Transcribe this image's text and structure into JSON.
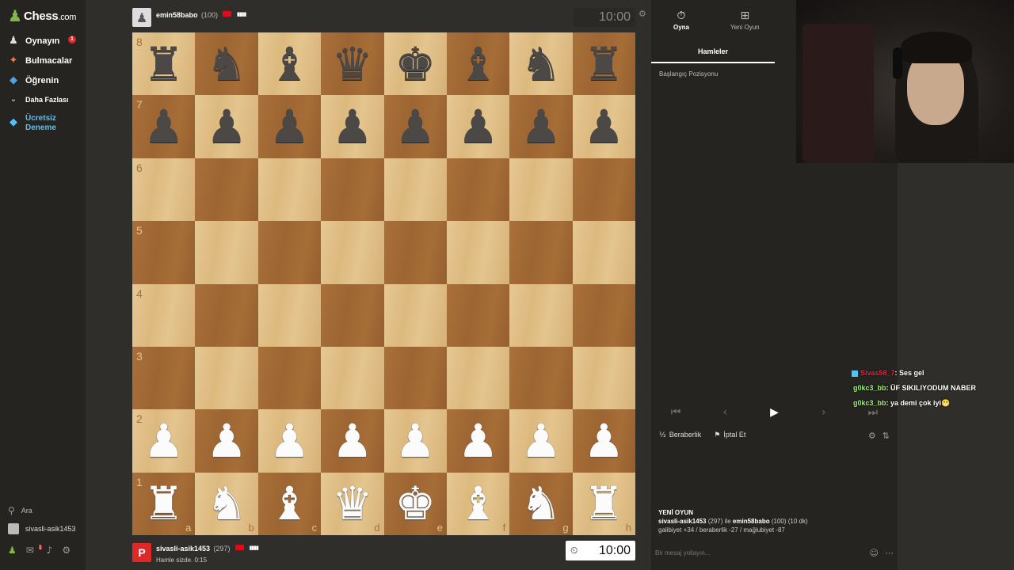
{
  "brand": {
    "logo_text": "Chess",
    "logo_suffix": ".com"
  },
  "sidebar": {
    "items": [
      {
        "label": "Oynayın",
        "icon": "play-pawn-icon",
        "badge": "1"
      },
      {
        "label": "Bulmacalar",
        "icon": "puzzle-icon"
      },
      {
        "label": "Öğrenin",
        "icon": "learn-cap-icon"
      },
      {
        "label": "Daha Fazlası",
        "icon": "chevron-down-icon"
      }
    ],
    "trial_line1": "Ücretsiz",
    "trial_line2": "Deneme",
    "search_label": "Ara",
    "user_label": "sivasli-asik1453",
    "friends_badge": "1"
  },
  "opponent": {
    "name": "emin58babo",
    "rating": "(100)",
    "clock": "10:00"
  },
  "player": {
    "name": "sivasli-asik1453",
    "rating": "(297)",
    "status": "Hamle sizde. 0:15",
    "clock": "10:00"
  },
  "board": {
    "ranks": [
      "8",
      "7",
      "6",
      "5",
      "4",
      "3",
      "2",
      "1"
    ],
    "files": [
      "a",
      "b",
      "c",
      "d",
      "e",
      "f",
      "g",
      "h"
    ],
    "position": [
      [
        "br",
        "bn",
        "bb",
        "bq",
        "bk",
        "bb",
        "bn",
        "br"
      ],
      [
        "bp",
        "bp",
        "bp",
        "bp",
        "bp",
        "bp",
        "bp",
        "bp"
      ],
      [
        "",
        "",
        "",
        "",
        "",
        "",
        "",
        ""
      ],
      [
        "",
        "",
        "",
        "",
        "",
        "",
        "",
        ""
      ],
      [
        "",
        "",
        "",
        "",
        "",
        "",
        "",
        ""
      ],
      [
        "",
        "",
        "",
        "",
        "",
        "",
        "",
        ""
      ],
      [
        "wp",
        "wp",
        "wp",
        "wp",
        "wp",
        "wp",
        "wp",
        "wp"
      ],
      [
        "wr",
        "wn",
        "wb",
        "wq",
        "wk",
        "wb",
        "wn",
        "wr"
      ]
    ]
  },
  "panel": {
    "tab_play": "Oyna",
    "tab_new": "Yeni Oyun",
    "subtab_moves": "Hamleler",
    "start_position": "Başlangıç Pozisyonu",
    "draw_label": "Beraberlik",
    "abort_label": "İptal Et",
    "game_title": "YENİ OYUN",
    "game_white": "sivasli-asik1453",
    "game_white_rating": "(297)",
    "game_with": "ile",
    "game_black": "emin58babo",
    "game_black_rating": "(100)",
    "game_mode": "(10 dk)",
    "game_stats": "galibiyet +34 / beraberlik -27 / mağlubiyet -87",
    "message_placeholder": "Bir mesaj yollayın..."
  },
  "stream_chat": [
    {
      "user": "Sivas58_7",
      "text": ": Ses gel",
      "color": "red"
    },
    {
      "user": "g0kc3_bb",
      "text": ": ÜF SIKILIYODUM NABER",
      "color": "green"
    },
    {
      "user": "g0kc3_bb",
      "text": ": ya demi çok iyi😁",
      "color": "green"
    }
  ],
  "colors": {
    "accent_green": "#81b64c",
    "board_light": "#e4c58e",
    "board_dark": "#a66d37",
    "trial_blue": "#4fc3f7",
    "badge_red": "#e02828"
  }
}
